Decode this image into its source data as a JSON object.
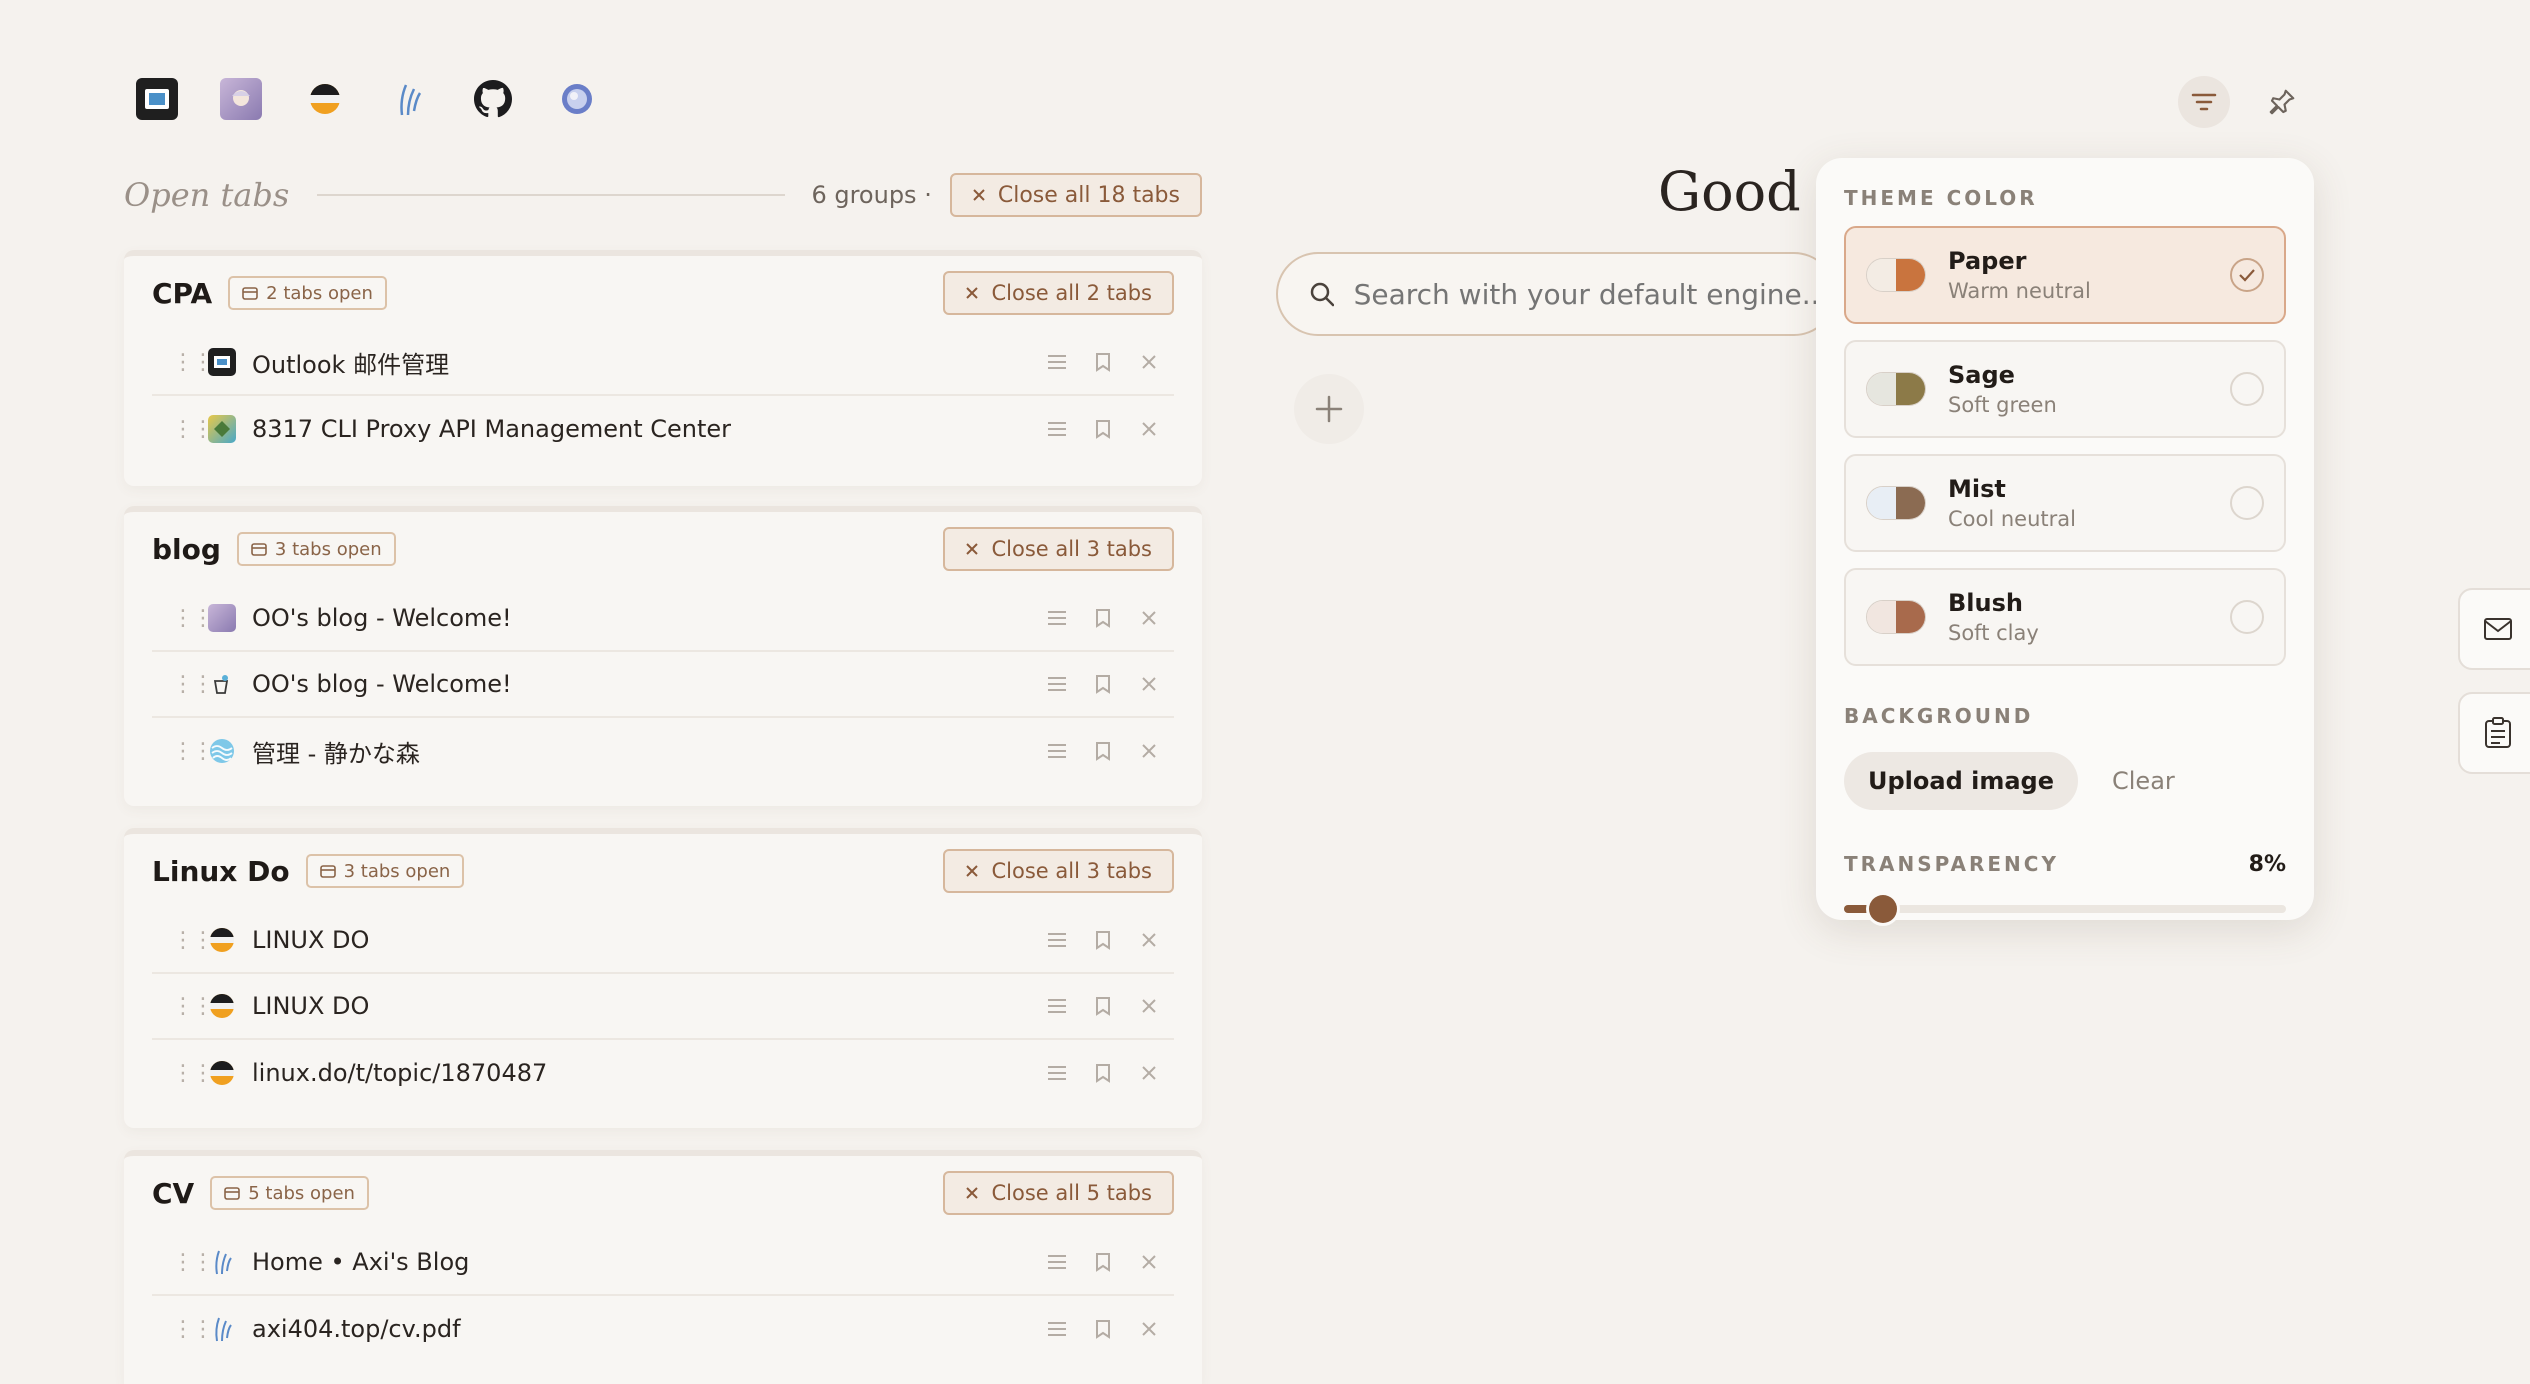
{
  "pinned_sites": [
    {
      "name": "outlook-favicon"
    },
    {
      "name": "anime-avatar-favicon"
    },
    {
      "name": "linux-do-favicon"
    },
    {
      "name": "axi-blog-favicon"
    },
    {
      "name": "github-icon"
    },
    {
      "name": "globe-favicon"
    }
  ],
  "open_tabs": {
    "title": "Open tabs",
    "groups_count": "6 groups",
    "separator": "·",
    "close_all": "Close all 18 tabs"
  },
  "groups": [
    {
      "name": "CPA",
      "badge": "2 tabs open",
      "close_label": "Close all 2 tabs",
      "tabs": [
        {
          "title": "Outlook 邮件管理"
        },
        {
          "title": "8317 CLI Proxy API Management Center"
        }
      ]
    },
    {
      "name": "blog",
      "badge": "3 tabs open",
      "close_label": "Close all 3 tabs",
      "tabs": [
        {
          "title": "OO's blog - Welcome!"
        },
        {
          "title": "OO's blog - Welcome!"
        },
        {
          "title": "管理 - 静かな森"
        }
      ]
    },
    {
      "name": "Linux Do",
      "badge": "3 tabs open",
      "close_label": "Close all 3 tabs",
      "tabs": [
        {
          "title": "LINUX DO"
        },
        {
          "title": "LINUX DO"
        },
        {
          "title": "linux.do/t/topic/1870487"
        }
      ]
    },
    {
      "name": "CV",
      "badge": "5 tabs open",
      "close_label": "Close all 5 tabs",
      "tabs": [
        {
          "title": "Home • Axi's Blog"
        },
        {
          "title": "axi404.top/cv.pdf"
        }
      ]
    }
  ],
  "greeting": "Good m",
  "search": {
    "placeholder": "Search with your default engine..."
  },
  "theme_panel": {
    "theme_label": "THEME COLOR",
    "options": [
      {
        "name": "Paper",
        "sub": "Warm neutral",
        "selected": true,
        "colors": [
          "#f3ece4",
          "#c9743e"
        ]
      },
      {
        "name": "Sage",
        "sub": "Soft green",
        "selected": false,
        "colors": [
          "#e6e6df",
          "#8c7a48"
        ]
      },
      {
        "name": "Mist",
        "sub": "Cool neutral",
        "selected": false,
        "colors": [
          "#e8eef5",
          "#8b6b52"
        ]
      },
      {
        "name": "Blush",
        "sub": "Soft clay",
        "selected": false,
        "colors": [
          "#f1e6e0",
          "#a86a4c"
        ]
      }
    ],
    "background_label": "BACKGROUND",
    "upload_label": "Upload image",
    "clear_label": "Clear",
    "transparency_label": "TRANSPARENCY",
    "transparency_value": "8%",
    "transparency_fraction": 0.08
  },
  "colors": {
    "accent": "#8a5a3a",
    "background": "#f5f2ee",
    "selected_option": "#f6e9df"
  }
}
